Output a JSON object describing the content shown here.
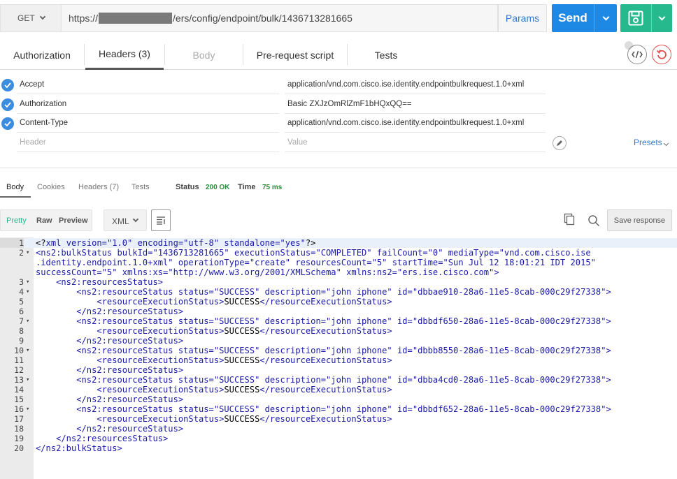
{
  "request": {
    "method": "GET",
    "url_prefix": "https://",
    "url_suffix": "/ers/config/endpoint/bulk/1436713281665",
    "params_label": "Params",
    "send_label": "Send"
  },
  "request_tabs": [
    {
      "label": "Authorization"
    },
    {
      "label": "Headers (3)"
    },
    {
      "label": "Body"
    },
    {
      "label": "Pre-request script"
    },
    {
      "label": "Tests"
    }
  ],
  "headers": [
    {
      "key": "Accept",
      "value": "application/vnd.com.cisco.ise.identity.endpointbulkrequest.1.0+xml"
    },
    {
      "key": "Authorization",
      "value": "Basic ZXJzOmRlZmF1bHQxQQ=="
    },
    {
      "key": "Content-Type",
      "value": "application/vnd.com.cisco.ise.identity.endpointbulkrequest.1.0+xml"
    }
  ],
  "header_placeholder": {
    "key": "Header",
    "value": "Value"
  },
  "presets_label": "Presets",
  "response_tabs": [
    {
      "label": "Body"
    },
    {
      "label": "Cookies"
    },
    {
      "label": "Headers (7)"
    },
    {
      "label": "Tests"
    }
  ],
  "response_meta": {
    "status_label": "Status",
    "status_value": "200 OK",
    "time_label": "Time",
    "time_value": "75 ms"
  },
  "format_buttons": [
    {
      "label": "Pretty"
    },
    {
      "label": "Raw"
    },
    {
      "label": "Preview"
    }
  ],
  "language": "XML",
  "save_response_label": "Save response",
  "code_lines": [
    {
      "n": "1",
      "fold": "",
      "html": "<span class=\"p\">&lt;?</span><span class=\"t\">xml</span> <span class=\"a\">version=</span><span class=\"s\">\"1.0\"</span> <span class=\"a\">encoding=</span><span class=\"s\">\"utf-8\"</span> <span class=\"a\">standalone=</span><span class=\"s\">\"yes\"</span><span class=\"p\">?&gt;</span>"
    },
    {
      "n": "2",
      "fold": "▾",
      "html": "<span class=\"t\">&lt;ns2:bulkStatus</span> <span class=\"a\">bulkId=</span><span class=\"s\">\"1436713281665\"</span> <span class=\"a\">executionStatus=</span><span class=\"s\">\"COMPLETED\"</span> <span class=\"a\">failCount=</span><span class=\"s\">\"0\"</span> <span class=\"a\">mediaType=</span><span class=\"s\">\"vnd.com.cisco.ise</span>"
    },
    {
      "n": "",
      "fold": "",
      "html": "<span class=\"s\">.identity.endpoint.1.0+xml\"</span> <span class=\"a\">operationType=</span><span class=\"s\">\"create\"</span> <span class=\"a\">resourcesCount=</span><span class=\"s\">\"5\"</span> <span class=\"a\">startTime=</span><span class=\"s\">\"Sun Jul 12 18:01:21 IDT 2015\"</span>"
    },
    {
      "n": "",
      "fold": "",
      "html": "<span class=\"a\">successCount=</span><span class=\"s\">\"5\"</span> <span class=\"a\">xmlns:xs=</span><span class=\"s\">\"http://www.w3.org/2001/XMLSchema\"</span> <span class=\"a\">xmlns:ns2=</span><span class=\"s\">\"ers.ise.cisco.com\"</span><span class=\"t\">&gt;</span>"
    },
    {
      "n": "3",
      "fold": "▾",
      "html": "    <span class=\"t\">&lt;ns2:resourcesStatus&gt;</span>"
    },
    {
      "n": "4",
      "fold": "▾",
      "html": "        <span class=\"t\">&lt;ns2:resourceStatus</span> <span class=\"a\">status=</span><span class=\"s\">\"SUCCESS\"</span> <span class=\"a\">description=</span><span class=\"s\">\"john iphone\"</span> <span class=\"a\">id=</span><span class=\"s\">\"dbbae910-28a6-11e5-8cab-000c29f27338\"</span><span class=\"t\">&gt;</span>"
    },
    {
      "n": "5",
      "fold": "",
      "html": "            <span class=\"t\">&lt;resourceExecutionStatus&gt;</span>SUCCESS<span class=\"t\">&lt;/resourceExecutionStatus&gt;</span>"
    },
    {
      "n": "6",
      "fold": "",
      "html": "        <span class=\"t\">&lt;/ns2:resourceStatus&gt;</span>"
    },
    {
      "n": "7",
      "fold": "▾",
      "html": "        <span class=\"t\">&lt;ns2:resourceStatus</span> <span class=\"a\">status=</span><span class=\"s\">\"SUCCESS\"</span> <span class=\"a\">description=</span><span class=\"s\">\"john iphone\"</span> <span class=\"a\">id=</span><span class=\"s\">\"dbbdf650-28a6-11e5-8cab-000c29f27338\"</span><span class=\"t\">&gt;</span>"
    },
    {
      "n": "8",
      "fold": "",
      "html": "            <span class=\"t\">&lt;resourceExecutionStatus&gt;</span>SUCCESS<span class=\"t\">&lt;/resourceExecutionStatus&gt;</span>"
    },
    {
      "n": "9",
      "fold": "",
      "html": "        <span class=\"t\">&lt;/ns2:resourceStatus&gt;</span>"
    },
    {
      "n": "10",
      "fold": "▾",
      "html": "        <span class=\"t\">&lt;ns2:resourceStatus</span> <span class=\"a\">status=</span><span class=\"s\">\"SUCCESS\"</span> <span class=\"a\">description=</span><span class=\"s\">\"john iphone\"</span> <span class=\"a\">id=</span><span class=\"s\">\"dbbb8550-28a6-11e5-8cab-000c29f27338\"</span><span class=\"t\">&gt;</span>"
    },
    {
      "n": "11",
      "fold": "",
      "html": "            <span class=\"t\">&lt;resourceExecutionStatus&gt;</span>SUCCESS<span class=\"t\">&lt;/resourceExecutionStatus&gt;</span>"
    },
    {
      "n": "12",
      "fold": "",
      "html": "        <span class=\"t\">&lt;/ns2:resourceStatus&gt;</span>"
    },
    {
      "n": "13",
      "fold": "▾",
      "html": "        <span class=\"t\">&lt;ns2:resourceStatus</span> <span class=\"a\">status=</span><span class=\"s\">\"SUCCESS\"</span> <span class=\"a\">description=</span><span class=\"s\">\"john iphone\"</span> <span class=\"a\">id=</span><span class=\"s\">\"dbba4cd0-28a6-11e5-8cab-000c29f27338\"</span><span class=\"t\">&gt;</span>"
    },
    {
      "n": "14",
      "fold": "",
      "html": "            <span class=\"t\">&lt;resourceExecutionStatus&gt;</span>SUCCESS<span class=\"t\">&lt;/resourceExecutionStatus&gt;</span>"
    },
    {
      "n": "15",
      "fold": "",
      "html": "        <span class=\"t\">&lt;/ns2:resourceStatus&gt;</span>"
    },
    {
      "n": "16",
      "fold": "▾",
      "html": "        <span class=\"t\">&lt;ns2:resourceStatus</span> <span class=\"a\">status=</span><span class=\"s\">\"SUCCESS\"</span> <span class=\"a\">description=</span><span class=\"s\">\"john iphone\"</span> <span class=\"a\">id=</span><span class=\"s\">\"dbbdf652-28a6-11e5-8cab-000c29f27338\"</span><span class=\"t\">&gt;</span>"
    },
    {
      "n": "17",
      "fold": "",
      "html": "            <span class=\"t\">&lt;resourceExecutionStatus&gt;</span>SUCCESS<span class=\"t\">&lt;/resourceExecutionStatus&gt;</span>"
    },
    {
      "n": "18",
      "fold": "",
      "html": "        <span class=\"t\">&lt;/ns2:resourceStatus&gt;</span>"
    },
    {
      "n": "19",
      "fold": "",
      "html": "    <span class=\"t\">&lt;/ns2:resourcesStatus&gt;</span>"
    },
    {
      "n": "20",
      "fold": "",
      "html": "<span class=\"t\">&lt;/ns2:bulkStatus&gt;</span>"
    }
  ],
  "colors": {
    "send": "#1e88e5",
    "save": "#26b98e",
    "link": "#3578c9",
    "status_ok": "#2e8b3a",
    "checkbox": "#3b8de0",
    "xml_markup": "#1a1aa6"
  },
  "icons": [
    "chevron-down-icon",
    "save-icon",
    "code-icon",
    "reset-icon",
    "check-icon",
    "edit-icon",
    "wrap-icon",
    "copy-icon",
    "search-icon"
  ]
}
